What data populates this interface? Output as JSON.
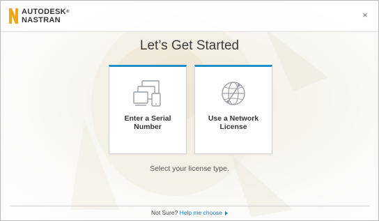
{
  "brand": {
    "line1": "AUTODESK",
    "line2": "NASTRAN",
    "trademark": "®",
    "logo_letter_color": "#f2a51a"
  },
  "window": {
    "close_label": "×"
  },
  "main": {
    "title": "Let’s Get Started",
    "hint": "Select your license type."
  },
  "cards": [
    {
      "label": "Enter a Serial\nNumber",
      "icon": "serial-number-devices-icon"
    },
    {
      "label": "Use a Network\nLicense",
      "icon": "network-globe-icon"
    }
  ],
  "footer": {
    "prompt": "Not Sure?",
    "link": "Help me choose"
  },
  "colors": {
    "accent": "#1e90c8",
    "link": "#1e7fc0"
  }
}
